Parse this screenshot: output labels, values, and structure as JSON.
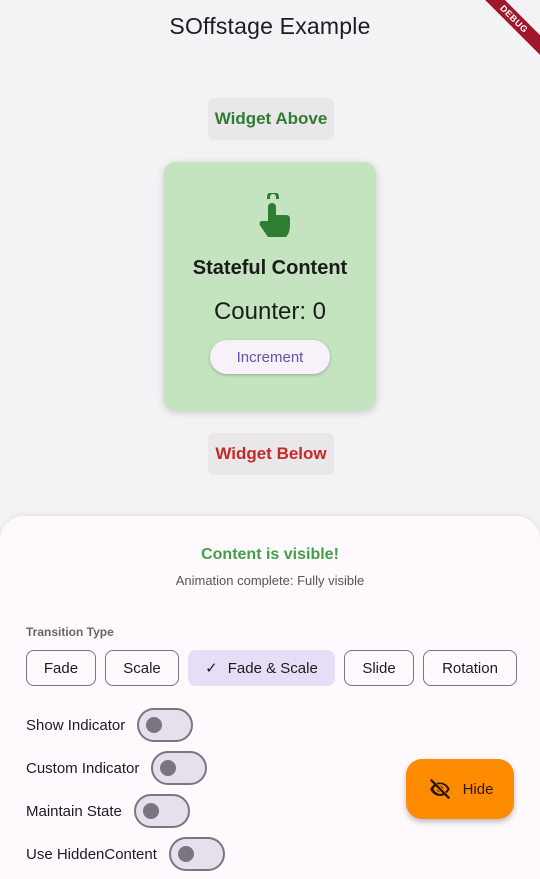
{
  "app": {
    "title": "SOffstage Example",
    "debug_banner": "DEBUG"
  },
  "preview": {
    "widget_above": "Widget Above",
    "widget_below": "Widget Below",
    "card": {
      "icon": "touch-app-icon",
      "title": "Stateful Content",
      "counter_text": "Counter: 0",
      "increment_label": "Increment",
      "background": "#c3e4bf",
      "icon_color": "#2e7d32"
    }
  },
  "controls": {
    "status_title": "Content is visible!",
    "status_subtitle": "Animation complete: Fully visible",
    "transition_label": "Transition Type",
    "transition_options": [
      {
        "label": "Fade",
        "selected": false
      },
      {
        "label": "Scale",
        "selected": false
      },
      {
        "label": "Fade & Scale",
        "selected": true
      },
      {
        "label": "Slide",
        "selected": false
      },
      {
        "label": "Rotation",
        "selected": false
      }
    ],
    "toggles": [
      {
        "label": "Show Indicator",
        "on": false
      },
      {
        "label": "Custom Indicator",
        "on": false
      },
      {
        "label": "Maintain State",
        "on": false
      },
      {
        "label": "Use HiddenContent",
        "on": false
      }
    ]
  },
  "fab": {
    "label": "Hide",
    "icon": "visibility-off-icon",
    "color": "#ff8c00"
  },
  "colors": {
    "above_text": "#2e7d32",
    "below_text": "#c62828",
    "status_green": "#43a047",
    "accent": "#6750a4"
  }
}
